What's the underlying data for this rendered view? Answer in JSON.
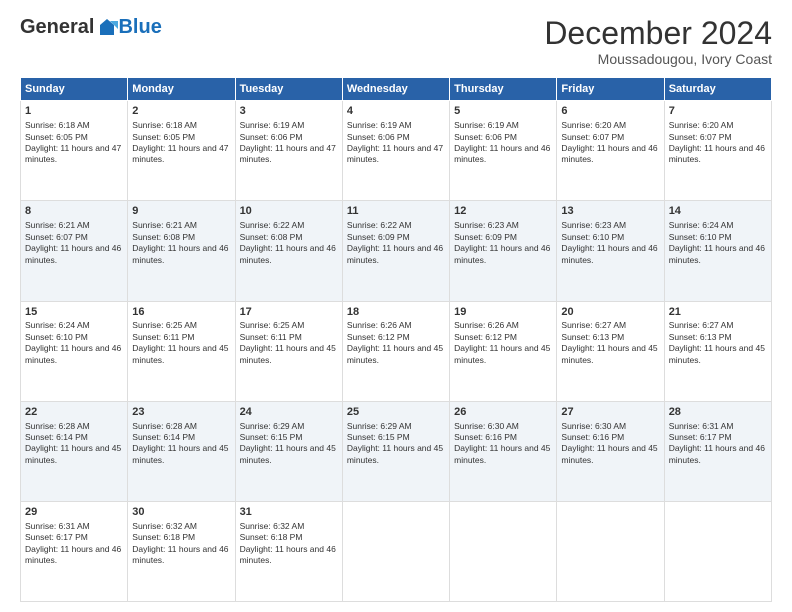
{
  "logo": {
    "general": "General",
    "blue": "Blue"
  },
  "title": "December 2024",
  "subtitle": "Moussadougou, Ivory Coast",
  "days_of_week": [
    "Sunday",
    "Monday",
    "Tuesday",
    "Wednesday",
    "Thursday",
    "Friday",
    "Saturday"
  ],
  "weeks": [
    [
      {
        "day": "1",
        "sunrise": "6:18 AM",
        "sunset": "6:05 PM",
        "daylight": "11 hours and 47 minutes."
      },
      {
        "day": "2",
        "sunrise": "6:18 AM",
        "sunset": "6:05 PM",
        "daylight": "11 hours and 47 minutes."
      },
      {
        "day": "3",
        "sunrise": "6:19 AM",
        "sunset": "6:06 PM",
        "daylight": "11 hours and 47 minutes."
      },
      {
        "day": "4",
        "sunrise": "6:19 AM",
        "sunset": "6:06 PM",
        "daylight": "11 hours and 47 minutes."
      },
      {
        "day": "5",
        "sunrise": "6:19 AM",
        "sunset": "6:06 PM",
        "daylight": "11 hours and 46 minutes."
      },
      {
        "day": "6",
        "sunrise": "6:20 AM",
        "sunset": "6:07 PM",
        "daylight": "11 hours and 46 minutes."
      },
      {
        "day": "7",
        "sunrise": "6:20 AM",
        "sunset": "6:07 PM",
        "daylight": "11 hours and 46 minutes."
      }
    ],
    [
      {
        "day": "8",
        "sunrise": "6:21 AM",
        "sunset": "6:07 PM",
        "daylight": "11 hours and 46 minutes."
      },
      {
        "day": "9",
        "sunrise": "6:21 AM",
        "sunset": "6:08 PM",
        "daylight": "11 hours and 46 minutes."
      },
      {
        "day": "10",
        "sunrise": "6:22 AM",
        "sunset": "6:08 PM",
        "daylight": "11 hours and 46 minutes."
      },
      {
        "day": "11",
        "sunrise": "6:22 AM",
        "sunset": "6:09 PM",
        "daylight": "11 hours and 46 minutes."
      },
      {
        "day": "12",
        "sunrise": "6:23 AM",
        "sunset": "6:09 PM",
        "daylight": "11 hours and 46 minutes."
      },
      {
        "day": "13",
        "sunrise": "6:23 AM",
        "sunset": "6:10 PM",
        "daylight": "11 hours and 46 minutes."
      },
      {
        "day": "14",
        "sunrise": "6:24 AM",
        "sunset": "6:10 PM",
        "daylight": "11 hours and 46 minutes."
      }
    ],
    [
      {
        "day": "15",
        "sunrise": "6:24 AM",
        "sunset": "6:10 PM",
        "daylight": "11 hours and 46 minutes."
      },
      {
        "day": "16",
        "sunrise": "6:25 AM",
        "sunset": "6:11 PM",
        "daylight": "11 hours and 45 minutes."
      },
      {
        "day": "17",
        "sunrise": "6:25 AM",
        "sunset": "6:11 PM",
        "daylight": "11 hours and 45 minutes."
      },
      {
        "day": "18",
        "sunrise": "6:26 AM",
        "sunset": "6:12 PM",
        "daylight": "11 hours and 45 minutes."
      },
      {
        "day": "19",
        "sunrise": "6:26 AM",
        "sunset": "6:12 PM",
        "daylight": "11 hours and 45 minutes."
      },
      {
        "day": "20",
        "sunrise": "6:27 AM",
        "sunset": "6:13 PM",
        "daylight": "11 hours and 45 minutes."
      },
      {
        "day": "21",
        "sunrise": "6:27 AM",
        "sunset": "6:13 PM",
        "daylight": "11 hours and 45 minutes."
      }
    ],
    [
      {
        "day": "22",
        "sunrise": "6:28 AM",
        "sunset": "6:14 PM",
        "daylight": "11 hours and 45 minutes."
      },
      {
        "day": "23",
        "sunrise": "6:28 AM",
        "sunset": "6:14 PM",
        "daylight": "11 hours and 45 minutes."
      },
      {
        "day": "24",
        "sunrise": "6:29 AM",
        "sunset": "6:15 PM",
        "daylight": "11 hours and 45 minutes."
      },
      {
        "day": "25",
        "sunrise": "6:29 AM",
        "sunset": "6:15 PM",
        "daylight": "11 hours and 45 minutes."
      },
      {
        "day": "26",
        "sunrise": "6:30 AM",
        "sunset": "6:16 PM",
        "daylight": "11 hours and 45 minutes."
      },
      {
        "day": "27",
        "sunrise": "6:30 AM",
        "sunset": "6:16 PM",
        "daylight": "11 hours and 45 minutes."
      },
      {
        "day": "28",
        "sunrise": "6:31 AM",
        "sunset": "6:17 PM",
        "daylight": "11 hours and 46 minutes."
      }
    ],
    [
      {
        "day": "29",
        "sunrise": "6:31 AM",
        "sunset": "6:17 PM",
        "daylight": "11 hours and 46 minutes."
      },
      {
        "day": "30",
        "sunrise": "6:32 AM",
        "sunset": "6:18 PM",
        "daylight": "11 hours and 46 minutes."
      },
      {
        "day": "31",
        "sunrise": "6:32 AM",
        "sunset": "6:18 PM",
        "daylight": "11 hours and 46 minutes."
      },
      null,
      null,
      null,
      null
    ]
  ]
}
